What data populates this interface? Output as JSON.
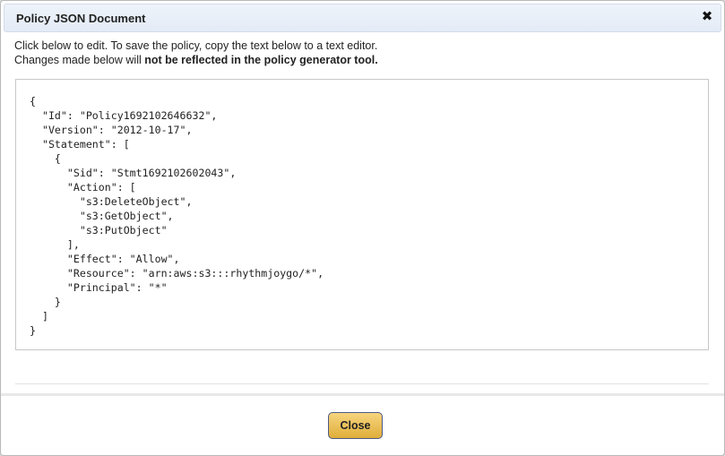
{
  "dialog": {
    "title": "Policy JSON Document",
    "close_icon": "close-x-icon"
  },
  "instructions": {
    "line1": "Click below to edit. To save the policy, copy the text below to a text editor.",
    "line2_prefix": "Changes made below will ",
    "line2_bold": "not be reflected in the policy generator tool."
  },
  "policy_document": "{\n  \"Id\": \"Policy1692102646632\",\n  \"Version\": \"2012-10-17\",\n  \"Statement\": [\n    {\n      \"Sid\": \"Stmt1692102602043\",\n      \"Action\": [\n        \"s3:DeleteObject\",\n        \"s3:GetObject\",\n        \"s3:PutObject\"\n      ],\n      \"Effect\": \"Allow\",\n      \"Resource\": \"arn:aws:s3:::rhythmjoygo/*\",\n      \"Principal\": \"*\"\n    }\n  ]\n}",
  "footer": {
    "close_label": "Close"
  },
  "colors": {
    "title_bar": "#e3ebf6",
    "button": "#e9bf55",
    "button_border": "#4b5a86"
  }
}
